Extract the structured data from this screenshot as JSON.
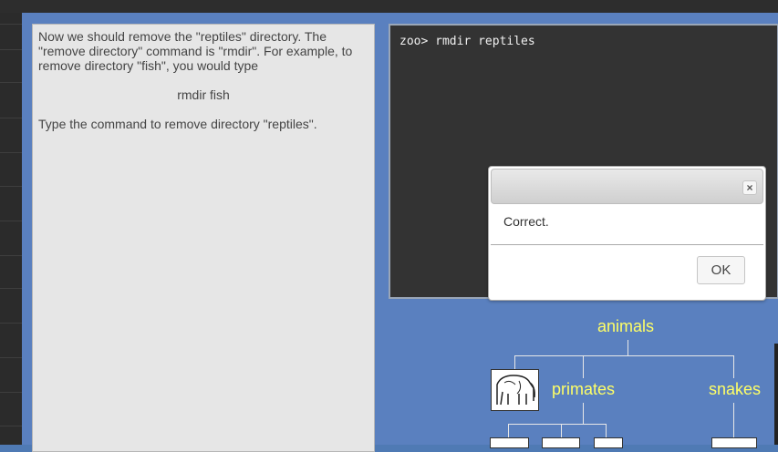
{
  "lesson": {
    "paragraph1": "Now we should remove the \"reptiles\" directory. The \"remove directory\" command is \"rmdir\". For example, to remove directory \"fish\", you would type",
    "example": "rmdir fish",
    "paragraph2": "Type the command to remove directory \"reptiles\"."
  },
  "terminal": {
    "line": "zoo> rmdir reptiles"
  },
  "dialog": {
    "close": "×",
    "message": "Correct.",
    "ok_label": "OK"
  },
  "tree": {
    "root": "animals",
    "child1": "primates",
    "child2": "snakes"
  }
}
